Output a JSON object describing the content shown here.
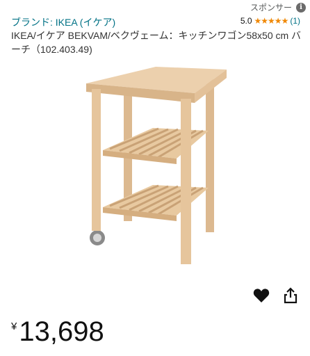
{
  "sponsor": {
    "label": "スポンサー",
    "icon": "info-icon",
    "icon_glyph": "i"
  },
  "brand": {
    "label": "ブランド: IKEA (イケア)"
  },
  "rating": {
    "score": "5.0",
    "stars": "★★★★★",
    "count": "(1)",
    "star_color": "#f08804"
  },
  "product": {
    "title": "IKEA/イケア BEKVAM/ベクヴェーム：キッチンワゴン58x50 cm バーチ（102.403.49)",
    "image": "birch-kitchen-trolley-image"
  },
  "actions": {
    "favorite_icon": "heart-icon",
    "share_icon": "share-icon"
  },
  "price": {
    "currency": "¥",
    "amount": "13,698"
  },
  "colors": {
    "link": "#007185",
    "wood": "#e9c9a3"
  }
}
